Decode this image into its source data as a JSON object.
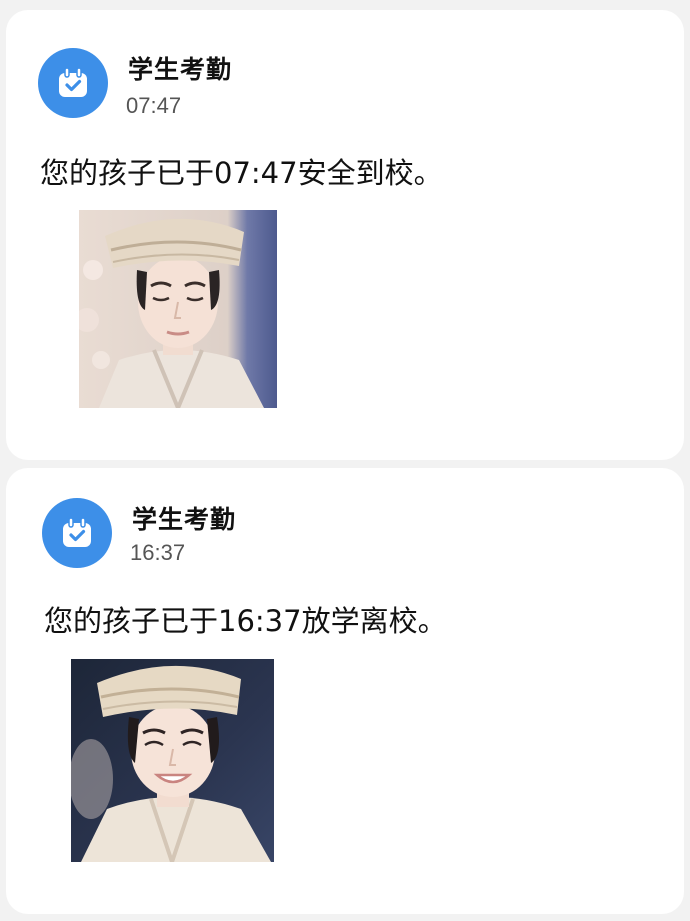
{
  "notifications": [
    {
      "app_name": "学生考勤",
      "time": "07:47",
      "icon": "calendar-check-icon",
      "message": "您的孩子已于07:47安全到校。",
      "photo": "student-arrival-photo"
    },
    {
      "app_name": "学生考勤",
      "time": "16:37",
      "icon": "calendar-check-icon",
      "message": "您的孩子已于16:37放学离校。",
      "photo": "student-departure-photo"
    }
  ],
  "colors": {
    "icon_background": "#3d8fe8",
    "card_background": "#ffffff",
    "page_background": "#f2f2f2"
  }
}
